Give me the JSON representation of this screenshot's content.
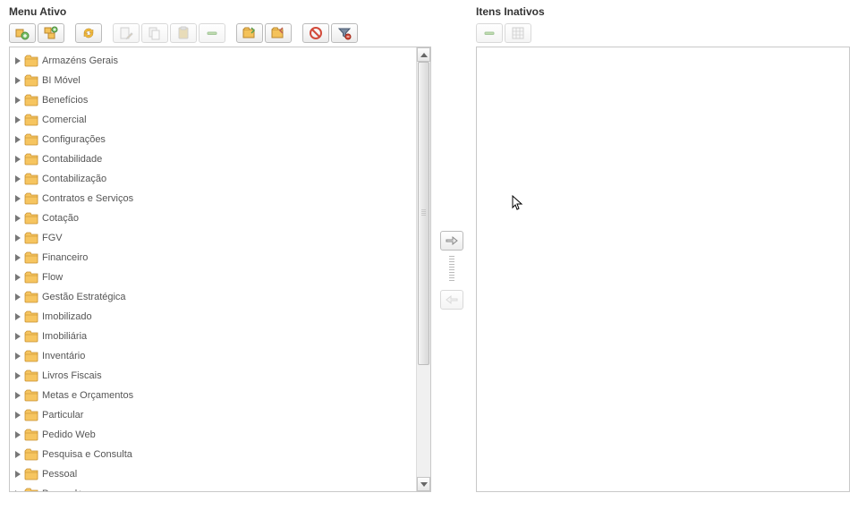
{
  "left": {
    "title": "Menu Ativo",
    "items": [
      "Armazéns Gerais",
      "BI Móvel",
      "Benefícios",
      "Comercial",
      "Configurações",
      "Contabilidade",
      "Contabilização",
      "Contratos e Serviços",
      "Cotação",
      "FGV",
      "Financeiro",
      "Flow",
      "Gestão Estratégica",
      "Imobilizado",
      "Imobiliária",
      "Inventário",
      "Livros Fiscais",
      "Metas e Orçamentos",
      "Particular",
      "Pedido Web",
      "Pesquisa e Consulta",
      "Pessoal",
      "Pessoal+"
    ]
  },
  "right": {
    "title": "Itens Inativos"
  },
  "toolbar_left": [
    {
      "name": "add-sibling",
      "enabled": true
    },
    {
      "name": "add-child",
      "enabled": true
    },
    {
      "name": "refresh",
      "enabled": true
    },
    {
      "name": "edit",
      "enabled": false
    },
    {
      "name": "copy",
      "enabled": false
    },
    {
      "name": "paste",
      "enabled": false
    },
    {
      "name": "remove",
      "enabled": false
    },
    {
      "name": "expand-all",
      "enabled": true
    },
    {
      "name": "collapse-all",
      "enabled": true
    },
    {
      "name": "block",
      "enabled": true
    },
    {
      "name": "filter",
      "enabled": true
    }
  ],
  "toolbar_right": [
    {
      "name": "remove",
      "enabled": false
    },
    {
      "name": "grid",
      "enabled": false
    }
  ]
}
